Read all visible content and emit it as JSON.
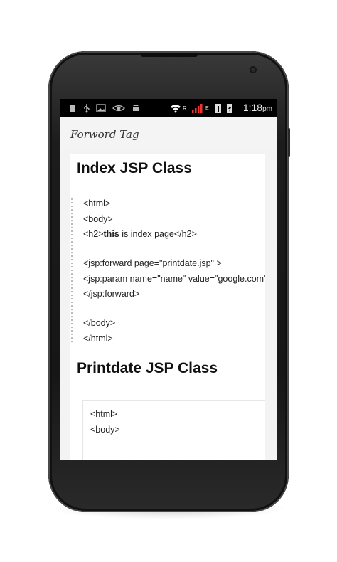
{
  "status_bar": {
    "time": "1:18",
    "time_suffix": "pm",
    "icons": [
      "sd-card-icon",
      "usb-icon",
      "image-icon",
      "eye-icon",
      "android-icon",
      "wifi-icon",
      "roaming-icon",
      "signal-icon",
      "edge-icon",
      "battery-icon",
      "charging-icon"
    ]
  },
  "app_bar": {
    "title": "Forword Tag"
  },
  "content": {
    "heading1": "Index JSP Class",
    "index_code": [
      "<html>",
      "<body>",
      "",
      "",
      "<jsp:forward page=\"printdate.jsp\" >",
      "<jsp:param name=\"name\" value=\"google.com\"",
      "</jsp:forward>",
      "",
      "</body>",
      "</html>"
    ],
    "h2_line": {
      "open": "<h2>",
      "bold": "this",
      "rest": " is index page</h2>"
    },
    "heading2": "Printdate JSP Class",
    "printdate_code": [
      "<html>",
      "<body>"
    ]
  }
}
